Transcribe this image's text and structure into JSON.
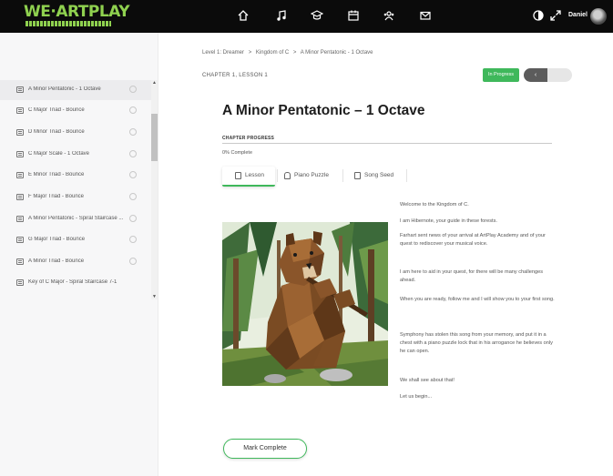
{
  "brand": {
    "logo_text": "WE·ARTPLAY",
    "accent": "#8fd14f"
  },
  "nav": {
    "icons": [
      "home-icon",
      "music-note-icon",
      "graduation-cap-icon",
      "calendar-icon",
      "group-icon",
      "mail-icon",
      "dark-mode-icon",
      "expand-icon"
    ],
    "user_name": "Daniel"
  },
  "sidebar": {
    "items": [
      {
        "label": "A Minor Pentatonic - 1 Octave",
        "active": true
      },
      {
        "label": "C Major Triad - Bounce"
      },
      {
        "label": "D Minor Triad - Bounce"
      },
      {
        "label": "C Major Scale - 1 Octave"
      },
      {
        "label": "E Minor Triad - Bounce"
      },
      {
        "label": "F Major Triad - Bounce"
      },
      {
        "label": "A Minor Pentatonic - Spiral Staircase ..."
      },
      {
        "label": "G Major Triad - Bounce"
      },
      {
        "label": "A Minor Triad - Bounce"
      },
      {
        "label": "Key of C Major - Spiral Staircase 7-1"
      }
    ]
  },
  "breadcrumb": [
    "Level 1: Dreamer",
    ">",
    "Kingdom of C",
    ">",
    "A Minor Pentatonic - 1 Octave"
  ],
  "chapter_label": "CHAPTER 1, LESSON 1",
  "status": {
    "label": "In Progress",
    "color": "#3fb85b"
  },
  "nav_prev_label": "‹",
  "lesson": {
    "title": "A Minor Pentatonic – 1 Octave",
    "progress_heading": "CHAPTER PROGRESS",
    "progress_text": "0% Complete",
    "progress_value": 0
  },
  "tabs": [
    {
      "label": "Lesson",
      "icon": "document-icon",
      "active": true
    },
    {
      "label": "Piano Puzzle",
      "icon": "lock-icon"
    },
    {
      "label": "Song Seed",
      "icon": "music-doc-icon"
    }
  ],
  "story": [
    "Welcome to the Kingdom of C.",
    "I am Hibernote, your guide in these forests.",
    "Farhart sent news of your arrival at ArtPlay Academy and of your quest to rediscover your musical voice.",
    "I am here to aid in your quest, for there will be many challenges ahead.",
    "When you are ready, follow me and I will show you to your first song.",
    "Symphony has stolen this song from your memory, and put it in a chest with a piano puzzle lock that in his arrogance he believes only he can open.",
    "We shall see about that!",
    "Let us begin..."
  ],
  "complete_button": "Mark Complete"
}
